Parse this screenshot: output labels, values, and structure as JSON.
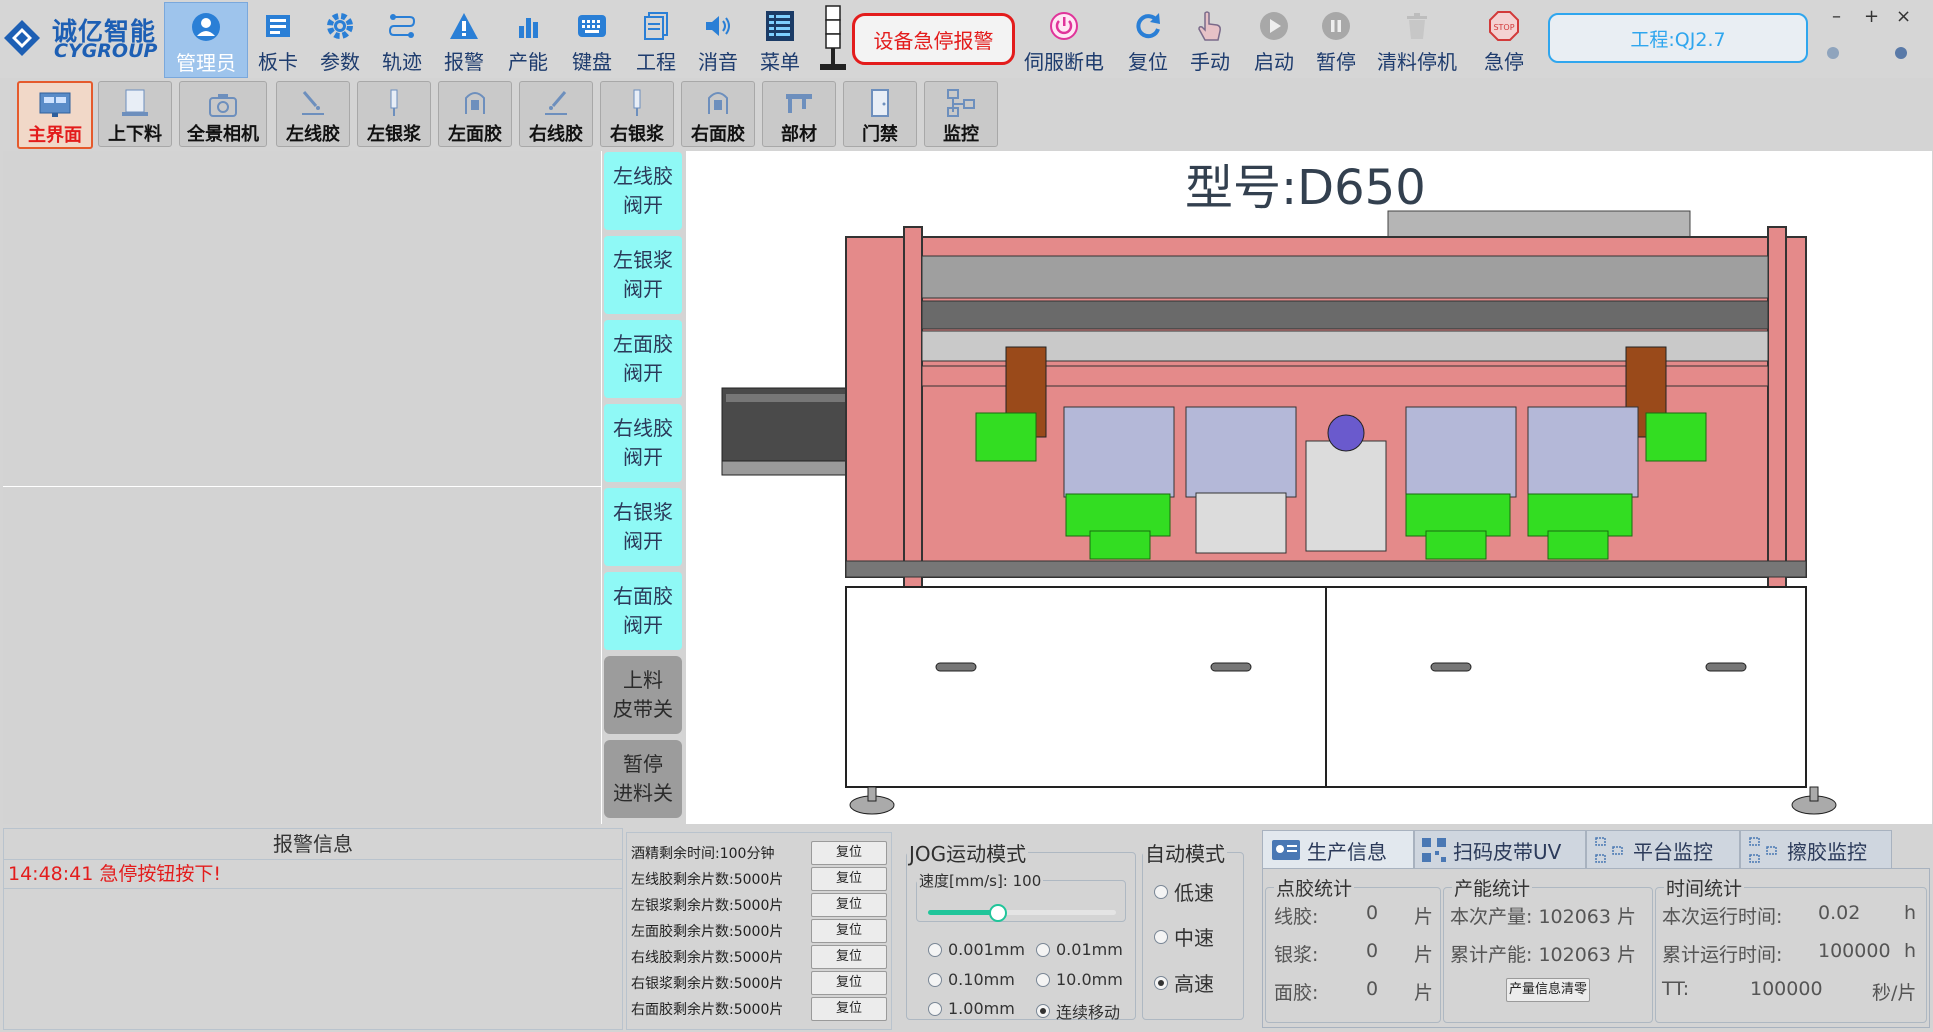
{
  "brand": {
    "name_cn": "诚亿智能",
    "name_en": "CYGROUP"
  },
  "toolbar": {
    "items": [
      {
        "label": "管理员",
        "icon": "user-icon",
        "active": true
      },
      {
        "label": "板卡",
        "icon": "board-card-icon"
      },
      {
        "label": "参数",
        "icon": "gear-icon"
      },
      {
        "label": "轨迹",
        "icon": "path-icon"
      },
      {
        "label": "报警",
        "icon": "warning-icon"
      },
      {
        "label": "产能",
        "icon": "bar-chart-icon"
      },
      {
        "label": "键盘",
        "icon": "keyboard-icon"
      },
      {
        "label": "工程",
        "icon": "documents-icon"
      },
      {
        "label": "消音",
        "icon": "speaker-icon"
      },
      {
        "label": "菜单",
        "icon": "menu-list-icon"
      }
    ],
    "emergency_alarm": "设备急停报警",
    "actions": [
      {
        "label": "伺服断电",
        "icon": "power-icon"
      },
      {
        "label": "复位",
        "icon": "refresh-icon"
      },
      {
        "label": "手动",
        "icon": "hand-pointer-icon"
      },
      {
        "label": "启动",
        "icon": "play-icon"
      },
      {
        "label": "暂停",
        "icon": "pause-icon"
      },
      {
        "label": "清料停机",
        "icon": "trash-icon"
      },
      {
        "label": "急停",
        "icon": "stop-sign-icon"
      }
    ],
    "project": "工程:QJ2.7",
    "window_controls": [
      "–",
      "+",
      "×"
    ]
  },
  "subtoolbar": {
    "items": [
      {
        "label": "主界面",
        "icon": "monitor-icon",
        "active": true
      },
      {
        "label": "上下料",
        "icon": "loader-icon"
      },
      {
        "label": "全景相机",
        "icon": "camera-icon"
      },
      {
        "label": "左线胶",
        "icon": "dispense-line-icon"
      },
      {
        "label": "左银浆",
        "icon": "syringe-icon"
      },
      {
        "label": "左面胶",
        "icon": "glue-face-icon"
      },
      {
        "label": "右线胶",
        "icon": "dispense-line-icon"
      },
      {
        "label": "右银浆",
        "icon": "syringe-icon"
      },
      {
        "label": "右面胶",
        "icon": "glue-face-icon"
      },
      {
        "label": "部材",
        "icon": "caliper-icon"
      },
      {
        "label": "门禁",
        "icon": "door-icon"
      },
      {
        "label": "监控",
        "icon": "monitor-tree-icon"
      }
    ]
  },
  "valves": [
    {
      "line1": "左线胶",
      "line2": "阀开"
    },
    {
      "line1": "左银浆",
      "line2": "阀开"
    },
    {
      "line1": "左面胶",
      "line2": "阀开"
    },
    {
      "line1": "右线胶",
      "line2": "阀开"
    },
    {
      "line1": "右银浆",
      "line2": "阀开"
    },
    {
      "line1": "右面胶",
      "line2": "阀开"
    }
  ],
  "switches": [
    {
      "line1": "上料",
      "line2": "皮带关"
    },
    {
      "line1": "暂停",
      "line2": "进料关"
    }
  ],
  "machine": {
    "model": "型号:D650"
  },
  "alarm": {
    "title": "报警信息",
    "entries": [
      {
        "time": "14:48:41",
        "text": "急停按钮按下!"
      }
    ]
  },
  "remaining": {
    "reset_label": "复位",
    "items": [
      "酒精剩余时间:100分钟",
      "左线胶剩余片数:5000片",
      "左银浆剩余片数:5000片",
      "左面胶剩余片数:5000片",
      "右线胶剩余片数:5000片",
      "右银浆剩余片数:5000片",
      "右面胶剩余片数:5000片"
    ]
  },
  "jog": {
    "title": "JOG运动模式",
    "speed_label": "速度[mm/s]: 100",
    "speed_value": 100,
    "speed_fraction": 0.36,
    "steps": [
      "0.001mm",
      "0.01mm",
      "0.10mm",
      "10.0mm",
      "1.00mm",
      "连续移动"
    ],
    "selected_step": "连续移动"
  },
  "auto": {
    "title": "自动模式",
    "options": [
      "低速",
      "中速",
      "高速"
    ],
    "selected": "高速"
  },
  "tabs": [
    {
      "label": "生产信息",
      "icon": "info-card-icon",
      "active": true
    },
    {
      "label": "扫码皮带UV",
      "icon": "qr-code-icon"
    },
    {
      "label": "平台监控",
      "icon": "network-icon"
    },
    {
      "label": "擦胶监控",
      "icon": "network-icon"
    }
  ],
  "production": {
    "glue": {
      "title": "点胶统计",
      "rows": [
        {
          "name": "线胶:",
          "value": "0",
          "unit": "片"
        },
        {
          "name": "银浆:",
          "value": "0",
          "unit": "片"
        },
        {
          "name": "面胶:",
          "value": "0",
          "unit": "片"
        }
      ]
    },
    "capacity": {
      "title": "产能统计",
      "current": "本次产量: 102063 片",
      "total": "累计产能: 102063 片",
      "clear": "产量信息清零"
    },
    "time": {
      "title": "时间统计",
      "run_label": "本次运行时间:",
      "run_value": "0.02",
      "run_unit": "h",
      "total_label": "累计运行时间:",
      "total_value": "100000",
      "total_unit": "h",
      "tt_label": "TT:",
      "tt_value": "100000",
      "tt_unit": "秒/片"
    }
  },
  "colors": {
    "accent": "#2fa6ee",
    "alarm": "#e31c1c",
    "valve": "#8ff9f6",
    "frame": "#e07b7b",
    "green": "#33dd22"
  }
}
